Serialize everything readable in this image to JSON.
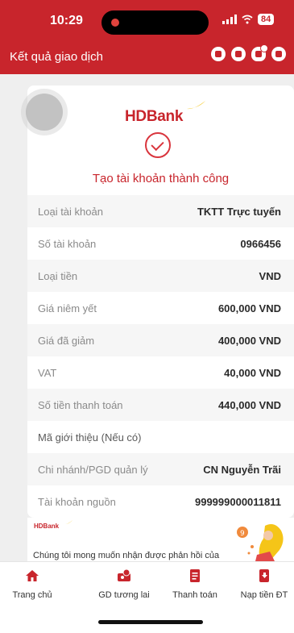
{
  "status": {
    "time": "10:29",
    "battery": "84"
  },
  "header": {
    "title": "Kết quả giao dịch"
  },
  "card": {
    "brand": "HDBank",
    "success_text": "Tạo tài khoản thành công",
    "rows": [
      {
        "label": "Loại tài khoản",
        "value": "TKTT Trực tuyến"
      },
      {
        "label": "Số tài khoản",
        "value": "0966456"
      },
      {
        "label": "Loại tiền",
        "value": "VND"
      },
      {
        "label": "Giá niêm yết",
        "value": "600,000 VND"
      },
      {
        "label": "Giá đã giảm",
        "value": "400,000 VND"
      },
      {
        "label": "VAT",
        "value": "40,000 VND"
      },
      {
        "label": "Số tiền thanh toán",
        "value": "440,000 VND"
      },
      {
        "label": "Mã giới thiệu (Nếu có)",
        "value": ""
      },
      {
        "label": "Chi nhánh/PGD quản lý",
        "value": "CN Nguyễn Trãi"
      },
      {
        "label": "Tài khoản nguồn",
        "value": "999999000011811"
      }
    ]
  },
  "banner": {
    "logo": "HDBank",
    "text": "Chúng tôi mong muốn nhận được phản hồi của"
  },
  "nav": {
    "items": [
      {
        "label": "Trang chủ",
        "icon": "home-icon"
      },
      {
        "label": "GD tương lai",
        "icon": "future-transaction-icon"
      },
      {
        "label": "Thanh toán",
        "icon": "bill-icon"
      },
      {
        "label": "Nạp tiền ĐT",
        "icon": "phone-topup-icon"
      }
    ]
  },
  "colors": {
    "brand_red": "#c8252c",
    "accent_yellow": "#f5c518"
  }
}
